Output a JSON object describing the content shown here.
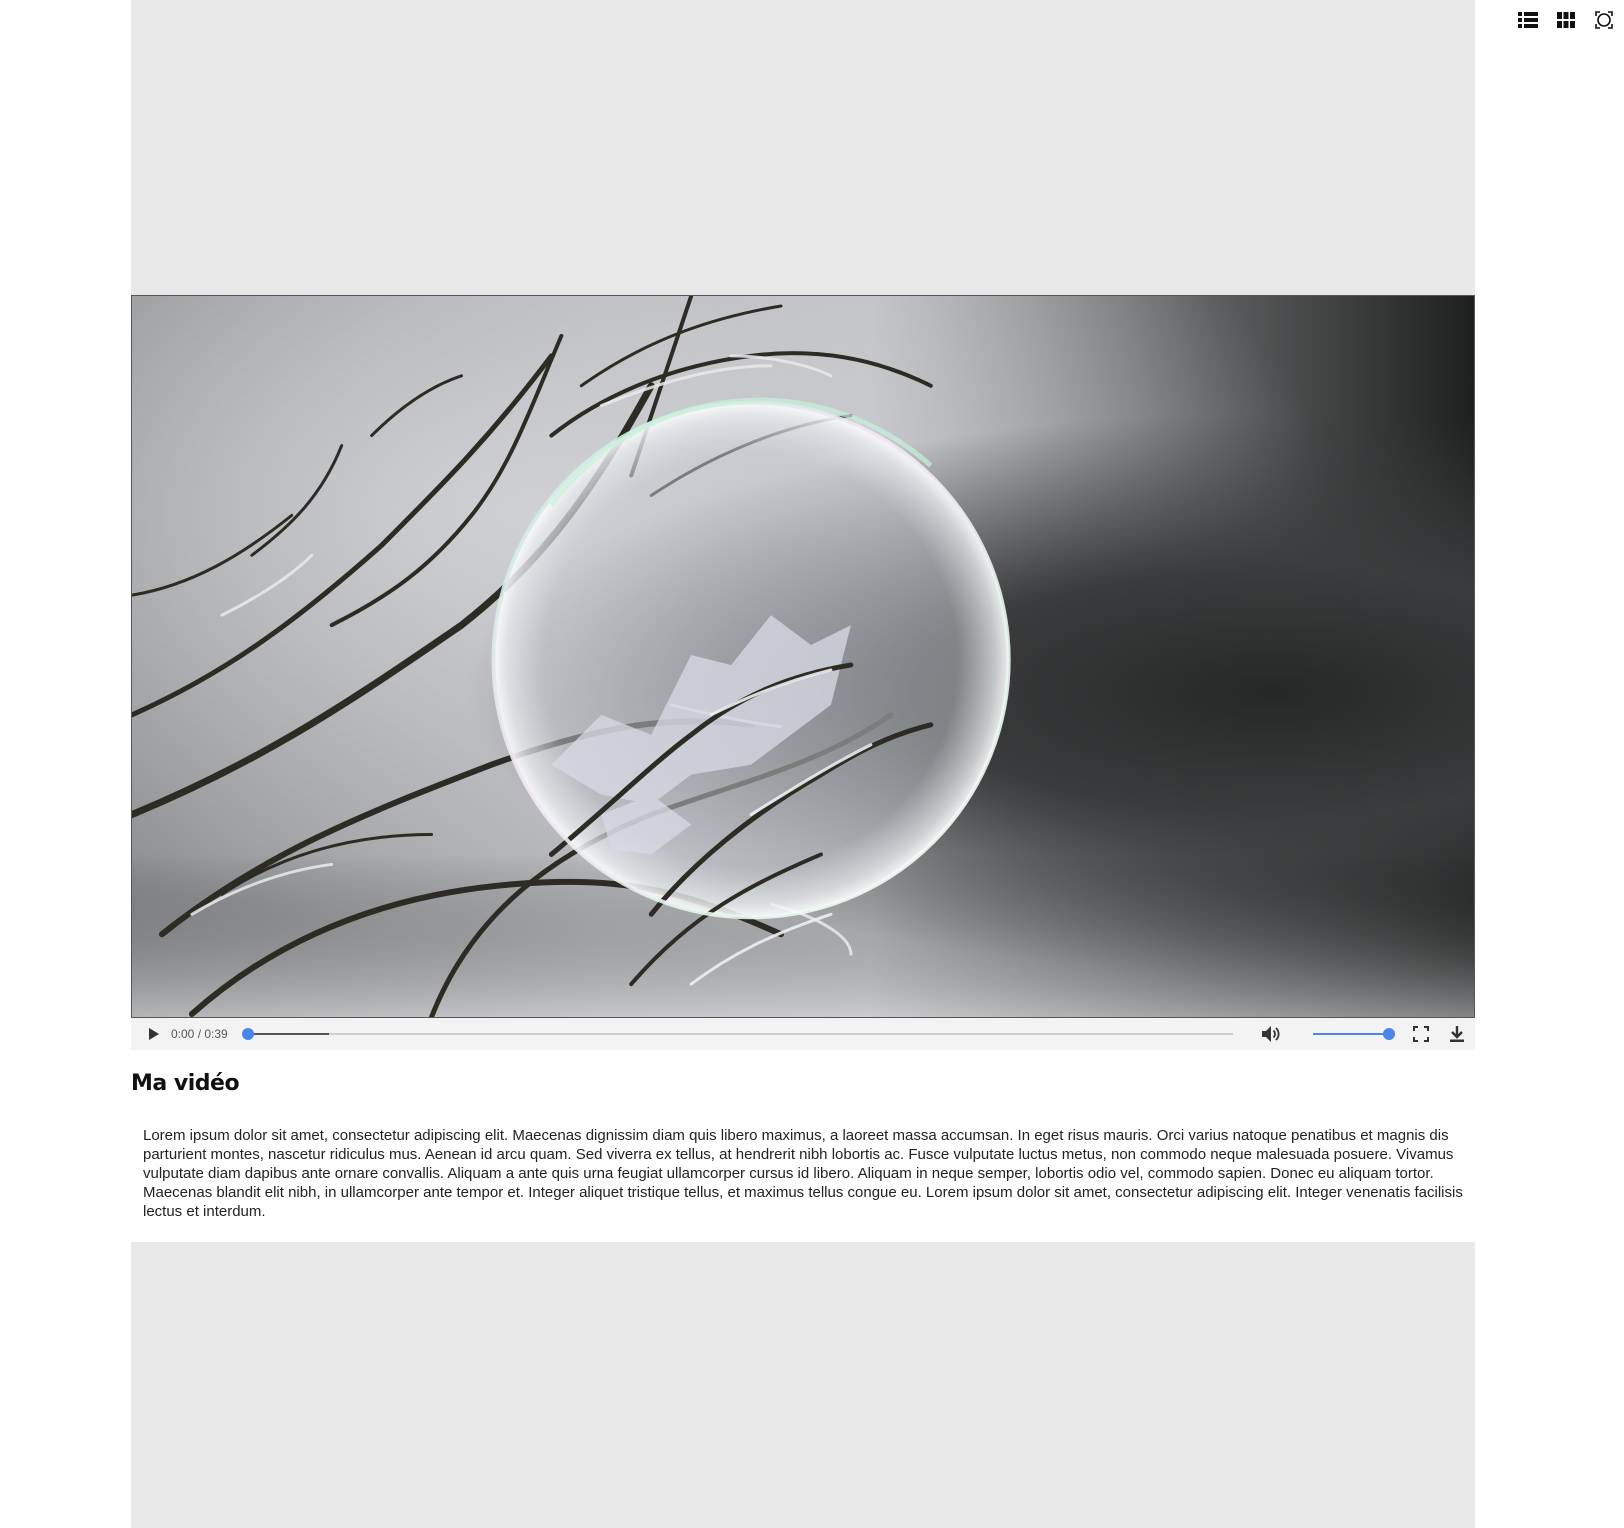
{
  "toolbar": {
    "icons": [
      "list-view-icon",
      "grid-view-icon",
      "fullscreen-icon"
    ]
  },
  "video": {
    "time_display": "0:00 / 0:39",
    "progress_fraction": 0.0,
    "buffered_fraction": 0.083,
    "volume_fraction": 1.0,
    "colors": {
      "accent": "#4a86e8",
      "controls_bg": "#f3f3f3"
    },
    "control_icons": [
      "play-icon",
      "volume-icon",
      "fullscreen-icon",
      "download-icon"
    ]
  },
  "content": {
    "title": "Ma vidéo",
    "description": "Lorem ipsum dolor sit amet, consectetur adipiscing elit. Maecenas dignissim diam quis libero maximus, a laoreet massa accumsan. In eget risus mauris. Orci varius natoque penatibus et magnis dis parturient montes, nascetur ridiculus mus. Aenean id arcu quam. Sed viverra ex tellus, at hendrerit nibh lobortis ac. Fusce vulputate luctus metus, non commodo neque malesuada posuere. Vivamus vulputate diam dapibus ante ornare convallis. Aliquam a ante quis urna feugiat ullamcorper cursus id libero. Aliquam in neque semper, lobortis odio vel, commodo sapien. Donec eu aliquam tortor. Maecenas blandit elit nibh, in ullamcorper ante tempor et. Integer aliquet tristique tellus, et maximus tellus congue eu. Lorem ipsum dolor sit amet, consectetur adipiscing elit. Integer venenatis facilisis lectus et interdum."
  },
  "placeholders": {
    "color": "#e9e9e9"
  }
}
